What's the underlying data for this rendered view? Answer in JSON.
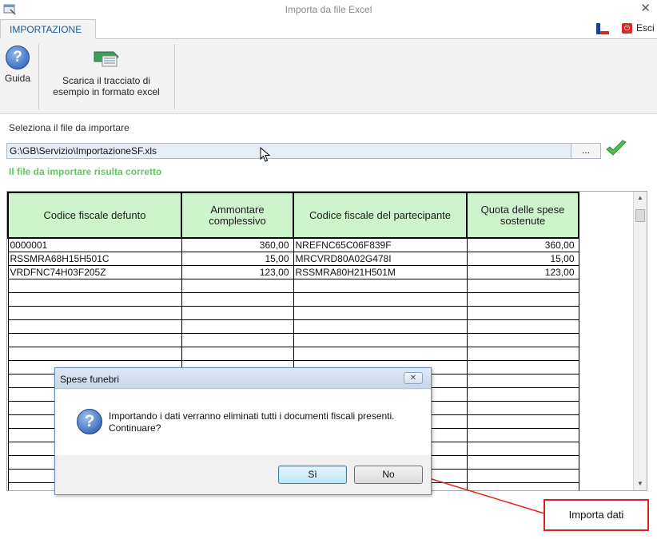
{
  "window": {
    "title": "Importa da file Excel",
    "close_glyph": "✕",
    "app_icon": "app-window-icon"
  },
  "tabs": [
    {
      "label": "IMPORTAZIONE",
      "active": true
    }
  ],
  "toolbar_right": {
    "flag_icon": "language-flag-icon",
    "exit_label": "Esci",
    "exit_icon": "exit-icon"
  },
  "ribbon": {
    "guida_label": "Guida",
    "scarica_line1": "Scarica il tracciato di",
    "scarica_line2": "esempio in formato excel"
  },
  "file_select": {
    "label": "Seleziona il file da importare",
    "path": "G:\\GB\\Servizio\\ImportazioneSF.xls",
    "browse_label": "...",
    "status_message": "Il file da importare risulta corretto",
    "status_color": "#5fca5f"
  },
  "grid": {
    "headers": [
      {
        "line1": "Codice fiscale defunto",
        "line2": ""
      },
      {
        "line1": "Ammontare",
        "line2": "complessivo"
      },
      {
        "line1": "Codice fiscale del partecipante",
        "line2": ""
      },
      {
        "line1": "Quota delle spese",
        "line2": "sostenute"
      }
    ],
    "rows": [
      [
        "0000001",
        "360,00",
        "NREFNC65C06F839F",
        "360,00"
      ],
      [
        "RSSMRA68H15H501C",
        "15,00",
        "MRCVRD80A02G478I",
        "15,00"
      ],
      [
        "VRDFNC74H03F205Z",
        "123,00",
        "RSSMRA80H21H501M",
        "123,00"
      ],
      [
        "",
        "",
        "",
        ""
      ],
      [
        "",
        "",
        "",
        ""
      ],
      [
        "",
        "",
        "",
        ""
      ],
      [
        "",
        "",
        "",
        ""
      ],
      [
        "",
        "",
        "",
        ""
      ],
      [
        "",
        "",
        "",
        ""
      ],
      [
        "",
        "",
        "",
        ""
      ],
      [
        "",
        "",
        "",
        ""
      ],
      [
        "",
        "",
        "",
        ""
      ],
      [
        "",
        "",
        "",
        ""
      ],
      [
        "",
        "",
        "",
        ""
      ],
      [
        "",
        "",
        "",
        ""
      ],
      [
        "",
        "",
        "",
        ""
      ],
      [
        "",
        "",
        "",
        ""
      ],
      [
        "",
        "",
        "",
        ""
      ],
      [
        "",
        "",
        "",
        ""
      ]
    ],
    "header_color": "#ccf5cc"
  },
  "dialog": {
    "title": "Spese funebri",
    "close_glyph": "✕",
    "message_line1": "Importando i dati verranno eliminati tutti i documenti fiscali presenti.",
    "message_line2": "Continuare?",
    "yes_label": "Sì",
    "no_label": "No"
  },
  "actions": {
    "import_label": "Importa dati",
    "highlight_color": "#e02020"
  }
}
